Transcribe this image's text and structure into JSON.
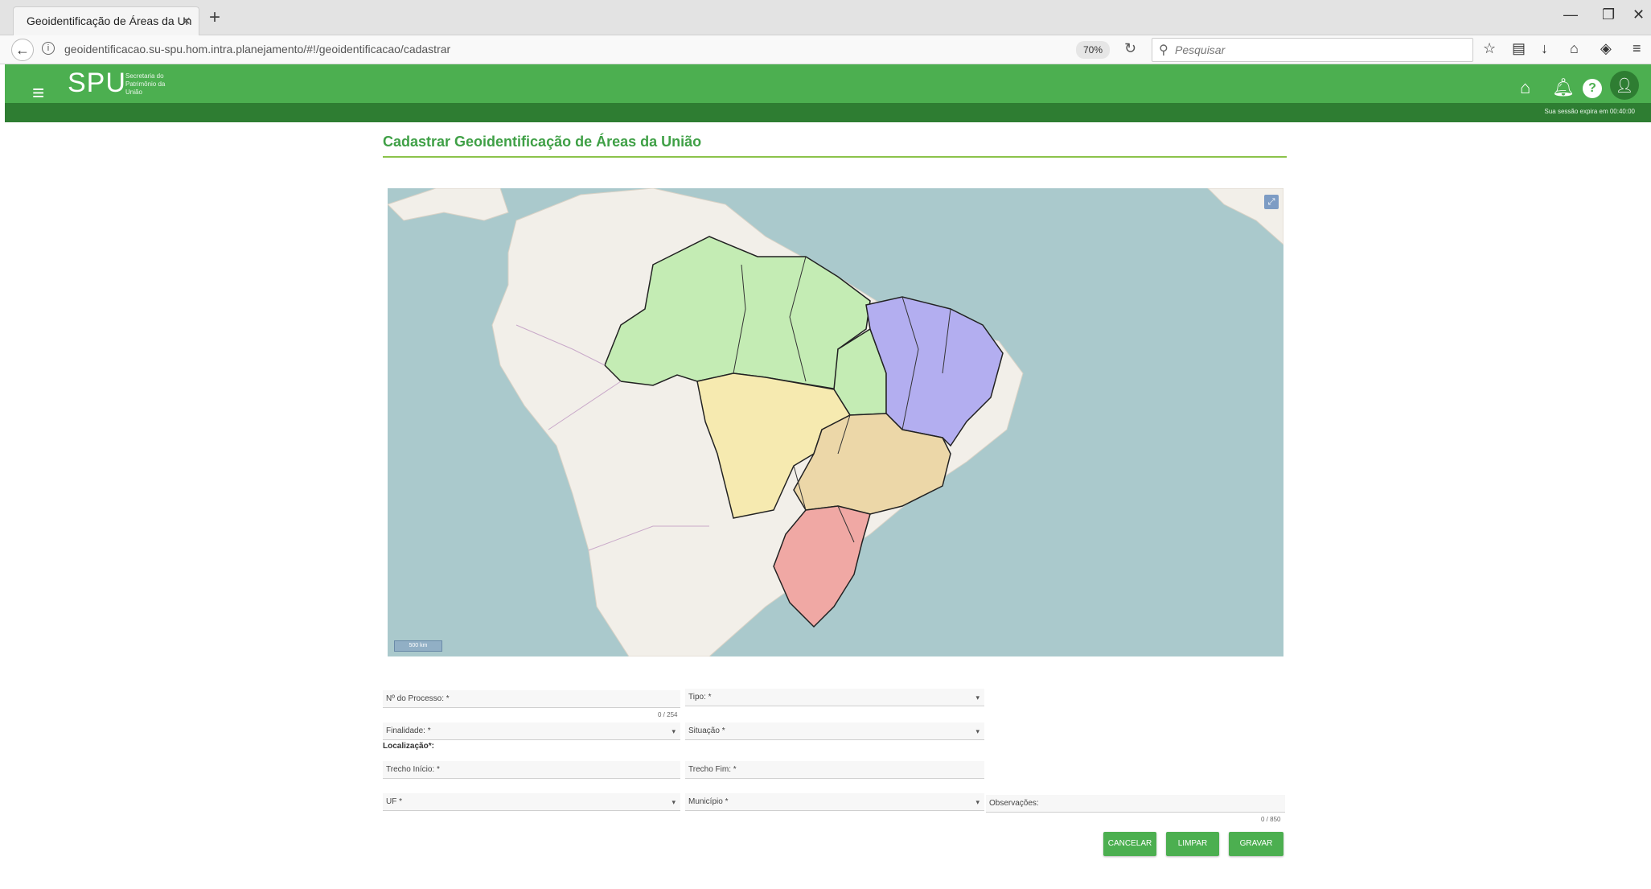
{
  "browser": {
    "tab_title": "Geoidentificação de Áreas da Un",
    "url": "geoidentificacao.su-spu.hom.intra.planejamento/#!/geoidentificacao/cadastrar",
    "zoom": "70%",
    "search_placeholder": "Pesquisar"
  },
  "header": {
    "logo": "SPU",
    "logo_sub": "Secretaria do Patrimônio da União",
    "session": "Sua sessão expira em 00:40:00"
  },
  "page": {
    "title": "Cadastrar Geoidentificação de Áreas da União"
  },
  "map": {
    "scale_label": "500 km",
    "region_colors": {
      "norte": "#c4ecb4",
      "nordeste": "#b3aef0",
      "centro_oeste": "#f6eab0",
      "sudeste": "#ecd7a8",
      "sul": "#f0a8a4",
      "land": "#f2efe9",
      "ocean": "#aac9cc"
    }
  },
  "form": {
    "processo_label": "Nº do Processo: *",
    "processo_counter": "0 / 254",
    "tipo_label": "Tipo: *",
    "finalidade_label": "Finalidade: *",
    "situacao_label": "Situação *",
    "localizacao_label": "Localização*:",
    "trecho_inicio_label": "Trecho Início: *",
    "trecho_fim_label": "Trecho Fim: *",
    "uf_label": "UF *",
    "municipio_label": "Município *",
    "observacoes_label": "Observações:",
    "observacoes_counter": "0 / 850"
  },
  "buttons": {
    "cancelar": "CANCELAR",
    "limpar": "LIMPAR",
    "gravar": "GRAVAR"
  },
  "colors": {
    "header_green": "#4caf50",
    "header_dark_green": "#2e7d32",
    "title_green": "#3fa046"
  }
}
